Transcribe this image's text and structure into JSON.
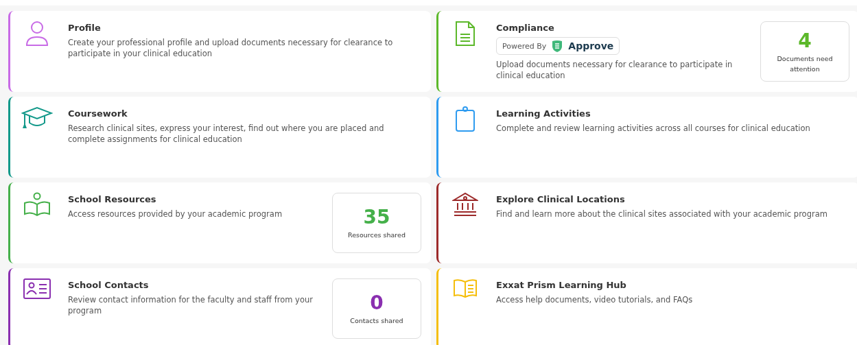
{
  "cards": [
    {
      "title": "Profile",
      "description": "Create your professional profile and upload documents necessary for clearance to participate in your clinical education",
      "color": "#c86be6"
    },
    {
      "title": "Compliance",
      "powered_by": {
        "label": "Powered By",
        "brand": "Approve"
      },
      "description": "Upload documents necessary for clearance to participate in clinical education",
      "color": "#5cb82a",
      "stat": {
        "value": "4",
        "label": "Documents need attention"
      }
    },
    {
      "title": "Coursework",
      "description": "Research clinical sites, express your interest, find out where you are placed and complete assignments for clinical education",
      "color": "#13998a"
    },
    {
      "title": "Learning Activities",
      "description": "Complete and review learning activities across all courses for clinical education",
      "color": "#2e9bf0"
    },
    {
      "title": "School Resources",
      "description": "Access resources provided by your academic program",
      "color": "#45b04a",
      "stat": {
        "value": "35",
        "label": "Resources shared"
      }
    },
    {
      "title": "Explore Clinical Locations",
      "description": "Find and learn more about the clinical sites associated with your academic program",
      "color": "#9c2a2a"
    },
    {
      "title": "School Contacts",
      "description": "Review contact information for the faculty and staff from your program",
      "color": "#8a2fb0",
      "stat": {
        "value": "0",
        "label": "Contacts shared"
      }
    },
    {
      "title": "Exxat Prism Learning Hub",
      "description": "Access help documents, video tutorials, and FAQs",
      "color": "#f5be0a"
    }
  ]
}
